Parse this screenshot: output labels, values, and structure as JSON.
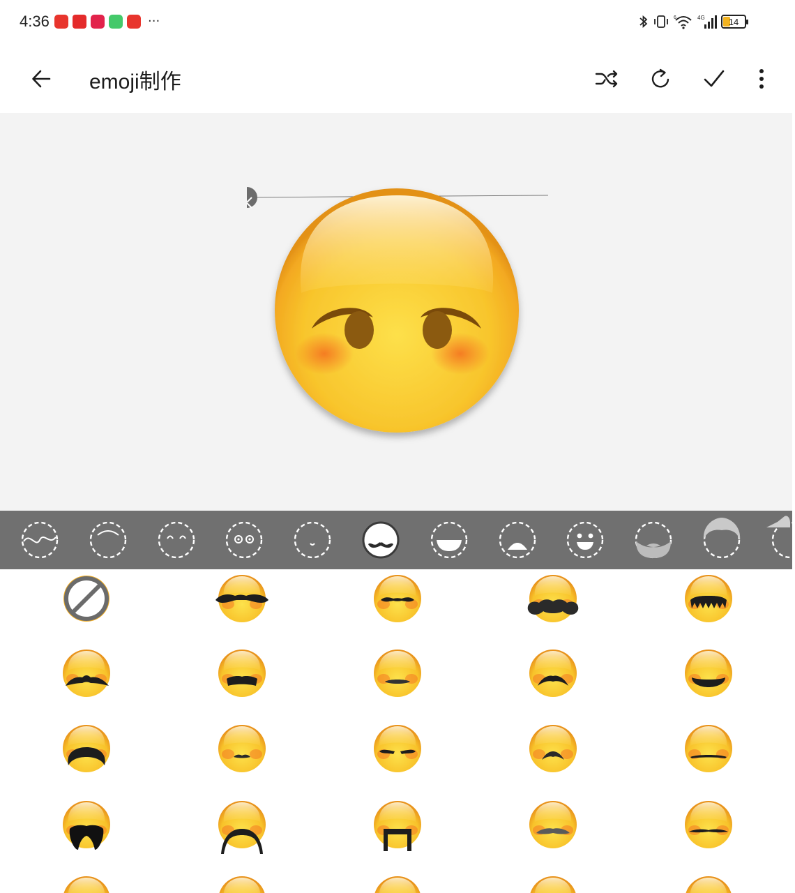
{
  "status_bar": {
    "time": "4:36",
    "more": "···",
    "battery_level": "14",
    "notification_icons": [
      "video-app-icon",
      "alert-app-icon",
      "shop-app-icon",
      "chat-app-icon",
      "news-app-icon"
    ],
    "system_icons": [
      "bluetooth-icon",
      "vibrate-icon",
      "wifi-icon",
      "cellular-4g-icon",
      "battery-icon"
    ]
  },
  "app_bar": {
    "title": "emoji制作",
    "actions": [
      "shuffle-icon",
      "refresh-icon",
      "check-icon",
      "more-vert-icon"
    ]
  },
  "preview": {
    "face_color": "#f7c22b",
    "eye_color": "#8b5a10",
    "blush_color": "#f57d24"
  },
  "categories": {
    "selected_index": 5,
    "items": [
      {
        "name": "outline",
        "selected": false
      },
      {
        "name": "eyebrows",
        "selected": false
      },
      {
        "name": "eyes-closed",
        "selected": false
      },
      {
        "name": "eyes",
        "selected": false
      },
      {
        "name": "mouth-small",
        "selected": false
      },
      {
        "name": "mustache",
        "selected": true
      },
      {
        "name": "mouth",
        "selected": false
      },
      {
        "name": "mouth-open",
        "selected": false
      },
      {
        "name": "face-full",
        "selected": false
      },
      {
        "name": "beard",
        "selected": false
      },
      {
        "name": "hair",
        "selected": false
      },
      {
        "name": "hat",
        "selected": false
      }
    ]
  },
  "mustache_grid": {
    "columns": 5,
    "items": [
      {
        "name": "none"
      },
      {
        "name": "handlebar-large"
      },
      {
        "name": "handlebar-small"
      },
      {
        "name": "big-curly"
      },
      {
        "name": "fringe"
      },
      {
        "name": "bushy-wide"
      },
      {
        "name": "thick-bar"
      },
      {
        "name": "thin-dash"
      },
      {
        "name": "arch"
      },
      {
        "name": "smile-bar"
      },
      {
        "name": "horseshoe-full"
      },
      {
        "name": "tiny-pointed"
      },
      {
        "name": "split-curl"
      },
      {
        "name": "small-arch"
      },
      {
        "name": "straight-line"
      },
      {
        "name": "walrus"
      },
      {
        "name": "long-droop"
      },
      {
        "name": "square-frame"
      },
      {
        "name": "soft-brush"
      },
      {
        "name": "pencil-thin"
      },
      {
        "name": "partial-1"
      },
      {
        "name": "partial-2"
      },
      {
        "name": "partial-3"
      },
      {
        "name": "partial-4"
      },
      {
        "name": "partial-5"
      }
    ]
  }
}
